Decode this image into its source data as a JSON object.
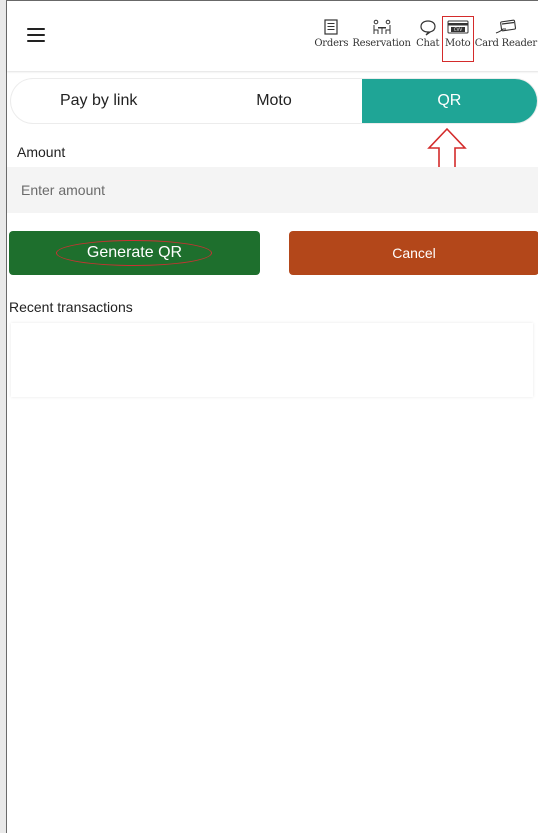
{
  "header": {
    "menu_icon": "hamburger-icon",
    "nav": [
      {
        "label": "Orders",
        "icon": "orders-icon"
      },
      {
        "label": "Reservation",
        "icon": "reservation-icon"
      },
      {
        "label": "Chat",
        "icon": "chat-icon"
      },
      {
        "label": "Moto",
        "icon": "cvv-card-icon",
        "highlighted": true
      },
      {
        "label": "Card Reader",
        "icon": "card-reader-icon"
      }
    ]
  },
  "tabs": [
    {
      "label": "Pay by link",
      "active": false
    },
    {
      "label": "Moto",
      "active": false
    },
    {
      "label": "QR",
      "active": true
    }
  ],
  "form": {
    "amount_label": "Amount",
    "amount_placeholder": "Enter amount",
    "amount_value": ""
  },
  "actions": {
    "generate_label": "Generate QR",
    "cancel_label": "Cancel"
  },
  "recent": {
    "label": "Recent transactions",
    "items": []
  },
  "colors": {
    "active_tab": "#1fa596",
    "generate_button": "#1e6f2d",
    "cancel_button": "#b3471a",
    "annotation": "#d42b2b"
  },
  "nav_cvv_text": "CVV"
}
